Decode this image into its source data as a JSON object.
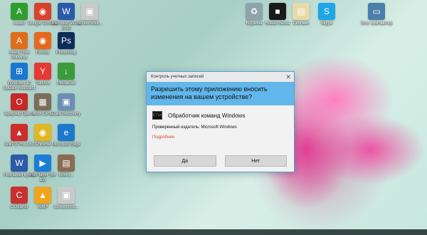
{
  "desktop": {
    "icons": [
      {
        "label": "Avast!",
        "glyph": "A",
        "color": "#2e9e2e"
      },
      {
        "label": "Google Chrome",
        "glyph": "◉",
        "color": "#d9412d"
      },
      {
        "label": "Microsoft Word 2010",
        "glyph": "W",
        "color": "#2a5aa8"
      },
      {
        "label": "Screenshot...",
        "glyph": "▣",
        "color": "#c9c9c9"
      },
      {
        "label": "Avast Free Antivirus",
        "glyph": "A",
        "color": "#e06d1a"
      },
      {
        "label": "Firefox",
        "glyph": "◉",
        "color": "#e5681e"
      },
      {
        "label": "Photoshop",
        "glyph": "Ps",
        "color": "#0d2d57"
      },
      {
        "label": "Windows 10 Update Assistant",
        "glyph": "⊞",
        "color": "#1b76d1"
      },
      {
        "label": "Yandex",
        "glyph": "Y",
        "color": "#e53935"
      },
      {
        "label": "MediaGet",
        "glyph": "↓",
        "color": "#3b9b3b"
      },
      {
        "label": "Браузер Opera",
        "glyph": "O",
        "color": "#c62828"
      },
      {
        "label": "Моя Сеть",
        "glyph": "▦",
        "color": "#7a6d5a"
      },
      {
        "label": "Data Recovery",
        "glyph": "▣",
        "color": "#6b8fb3"
      },
      {
        "label": "AIMP3 Pro 3.60",
        "glyph": "▲",
        "color": "#cf2c2c"
      },
      {
        "label": "Chrome",
        "glyph": "◉",
        "color": "#e2b623"
      },
      {
        "label": "Microsoft Edge",
        "glyph": "e",
        "color": "#1e78cc"
      },
      {
        "label": "Реальная кухня",
        "glyph": "W",
        "color": "#2a5aa8"
      },
      {
        "label": "PotPlayer (64 bit)",
        "glyph": "▶",
        "color": "#1a7fd4"
      },
      {
        "label": "Книги...",
        "glyph": "▤",
        "color": "#8a6c52"
      },
      {
        "label": "CCleaner",
        "glyph": "C",
        "color": "#c7312e"
      },
      {
        "label": "AIMP",
        "glyph": "▲",
        "color": "#f0a31c"
      },
      {
        "label": "Screenshot...",
        "glyph": "▣",
        "color": "#c9c9c9"
      },
      {
        "label": "Корзина",
        "glyph": "♻",
        "color": "#8fa4a8"
      },
      {
        "label": "Новая папка",
        "glyph": "■",
        "color": "#1a1a1a"
      },
      {
        "label": "Сколько",
        "glyph": "▤",
        "color": "#e8d9a8"
      },
      {
        "label": "Skype",
        "glyph": "S",
        "color": "#1ea6e6"
      },
      {
        "label": "Этот компьютер",
        "glyph": "▭",
        "color": "#4a7fa9"
      }
    ]
  },
  "dialog": {
    "title": "Контроль учетных записей",
    "close_label": "✕",
    "question": "Разрешить этому приложению вносить изменения на вашем устройстве?",
    "program_icon_text": "C:\\>",
    "program_name": "Обработчик команд Windows",
    "publisher": "Проверенный издатель: Microsoft Windows",
    "details_link": "Подробнее",
    "yes_label": "Да",
    "no_label": "Нет"
  }
}
